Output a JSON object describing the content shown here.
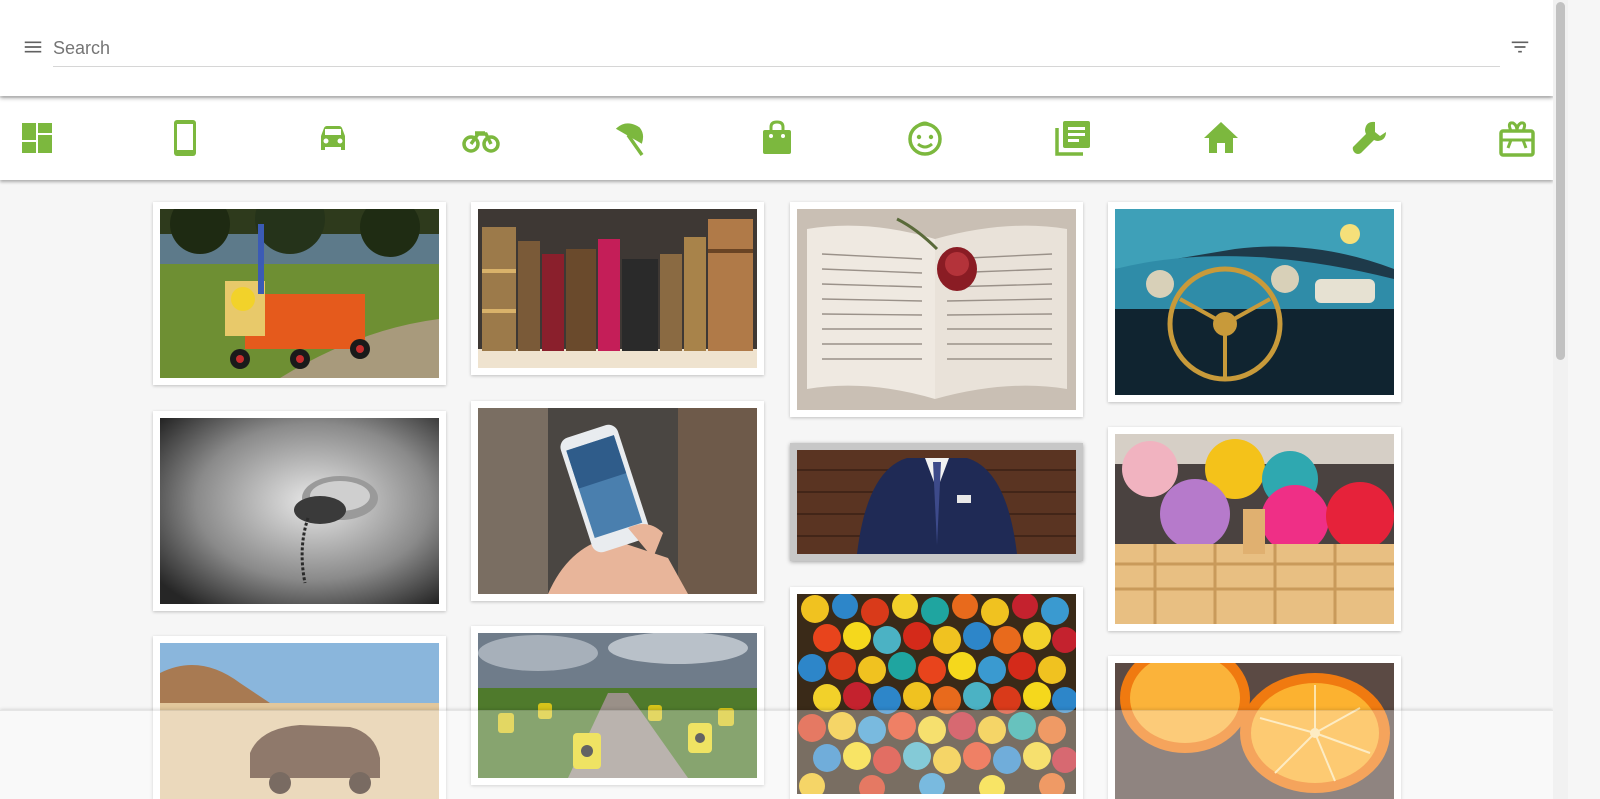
{
  "theme": {
    "accent": "#7cb83e",
    "icon_gray": "#616161"
  },
  "header": {
    "menu_icon": "hamburger-menu-icon",
    "search": {
      "placeholder": "Search",
      "value": ""
    },
    "filter_icon": "filter-list-icon"
  },
  "categories": [
    {
      "name": "all",
      "icon": "dashboard-icon"
    },
    {
      "name": "phones",
      "icon": "smartphone-icon"
    },
    {
      "name": "cars",
      "icon": "car-icon"
    },
    {
      "name": "motorcycles",
      "icon": "motorcycle-icon"
    },
    {
      "name": "leisure",
      "icon": "beach-umbrella-icon"
    },
    {
      "name": "fashion",
      "icon": "shopping-bag-icon"
    },
    {
      "name": "kids",
      "icon": "child-face-icon"
    },
    {
      "name": "books",
      "icon": "library-books-icon"
    },
    {
      "name": "real-estate",
      "icon": "home-icon"
    },
    {
      "name": "services",
      "icon": "wrench-icon"
    },
    {
      "name": "gifts",
      "icon": "gift-card-icon"
    }
  ],
  "listings": [
    {
      "image": "red-wooden-handcart-in-park"
    },
    {
      "image": "antique-leather-books-on-shelf"
    },
    {
      "image": "open-book-with-red-rose"
    },
    {
      "image": "vintage-convertible-dashboard"
    },
    {
      "image": "black-and-white-vintage-telephone"
    },
    {
      "image": "hand-holding-smartphone"
    },
    {
      "image": "man-in-navy-suit-and-tie",
      "selected": true
    },
    {
      "image": "balls-of-yarn-in-basket"
    },
    {
      "image": "rusted-car-wreck-in-desert"
    },
    {
      "image": "radioactive-barrels-in-field"
    },
    {
      "image": "colorful-glass-marbles"
    },
    {
      "image": "halved-oranges"
    }
  ]
}
